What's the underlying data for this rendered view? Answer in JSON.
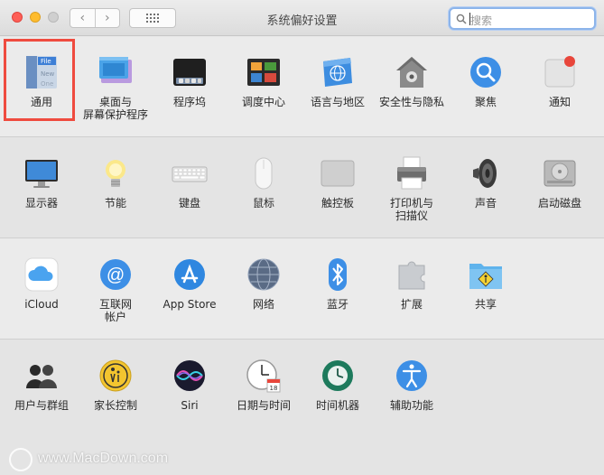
{
  "window": {
    "title": "系统偏好设置"
  },
  "search": {
    "placeholder": "搜索"
  },
  "rows": [
    [
      {
        "label": "通用",
        "icon": "general-icon"
      },
      {
        "label": "桌面与\n屏幕保护程序",
        "icon": "desktop-screensaver-icon"
      },
      {
        "label": "程序坞",
        "icon": "dock-icon"
      },
      {
        "label": "调度中心",
        "icon": "mission-control-icon"
      },
      {
        "label": "语言与地区",
        "icon": "language-region-icon"
      },
      {
        "label": "安全性与隐私",
        "icon": "security-privacy-icon"
      },
      {
        "label": "聚焦",
        "icon": "spotlight-icon"
      },
      {
        "label": "通知",
        "icon": "notifications-icon"
      }
    ],
    [
      {
        "label": "显示器",
        "icon": "displays-icon"
      },
      {
        "label": "节能",
        "icon": "energy-saver-icon"
      },
      {
        "label": "键盘",
        "icon": "keyboard-icon"
      },
      {
        "label": "鼠标",
        "icon": "mouse-icon"
      },
      {
        "label": "触控板",
        "icon": "trackpad-icon"
      },
      {
        "label": "打印机与\n扫描仪",
        "icon": "printers-scanners-icon"
      },
      {
        "label": "声音",
        "icon": "sound-icon"
      },
      {
        "label": "启动磁盘",
        "icon": "startup-disk-icon"
      }
    ],
    [
      {
        "label": "iCloud",
        "icon": "icloud-icon"
      },
      {
        "label": "互联网\n帐户",
        "icon": "internet-accounts-icon"
      },
      {
        "label": "App Store",
        "icon": "app-store-icon"
      },
      {
        "label": "网络",
        "icon": "network-icon"
      },
      {
        "label": "蓝牙",
        "icon": "bluetooth-icon"
      },
      {
        "label": "扩展",
        "icon": "extensions-icon"
      },
      {
        "label": "共享",
        "icon": "sharing-icon"
      }
    ],
    [
      {
        "label": "用户与群组",
        "icon": "users-groups-icon"
      },
      {
        "label": "家长控制",
        "icon": "parental-controls-icon"
      },
      {
        "label": "Siri",
        "icon": "siri-icon"
      },
      {
        "label": "日期与时间",
        "icon": "date-time-icon"
      },
      {
        "label": "时间机器",
        "icon": "time-machine-icon"
      },
      {
        "label": "辅助功能",
        "icon": "accessibility-icon"
      }
    ]
  ],
  "general_icon_text": [
    "File",
    "New",
    "One"
  ],
  "calendar_day": "18",
  "watermark": {
    "text": "www.MacDown.com"
  }
}
